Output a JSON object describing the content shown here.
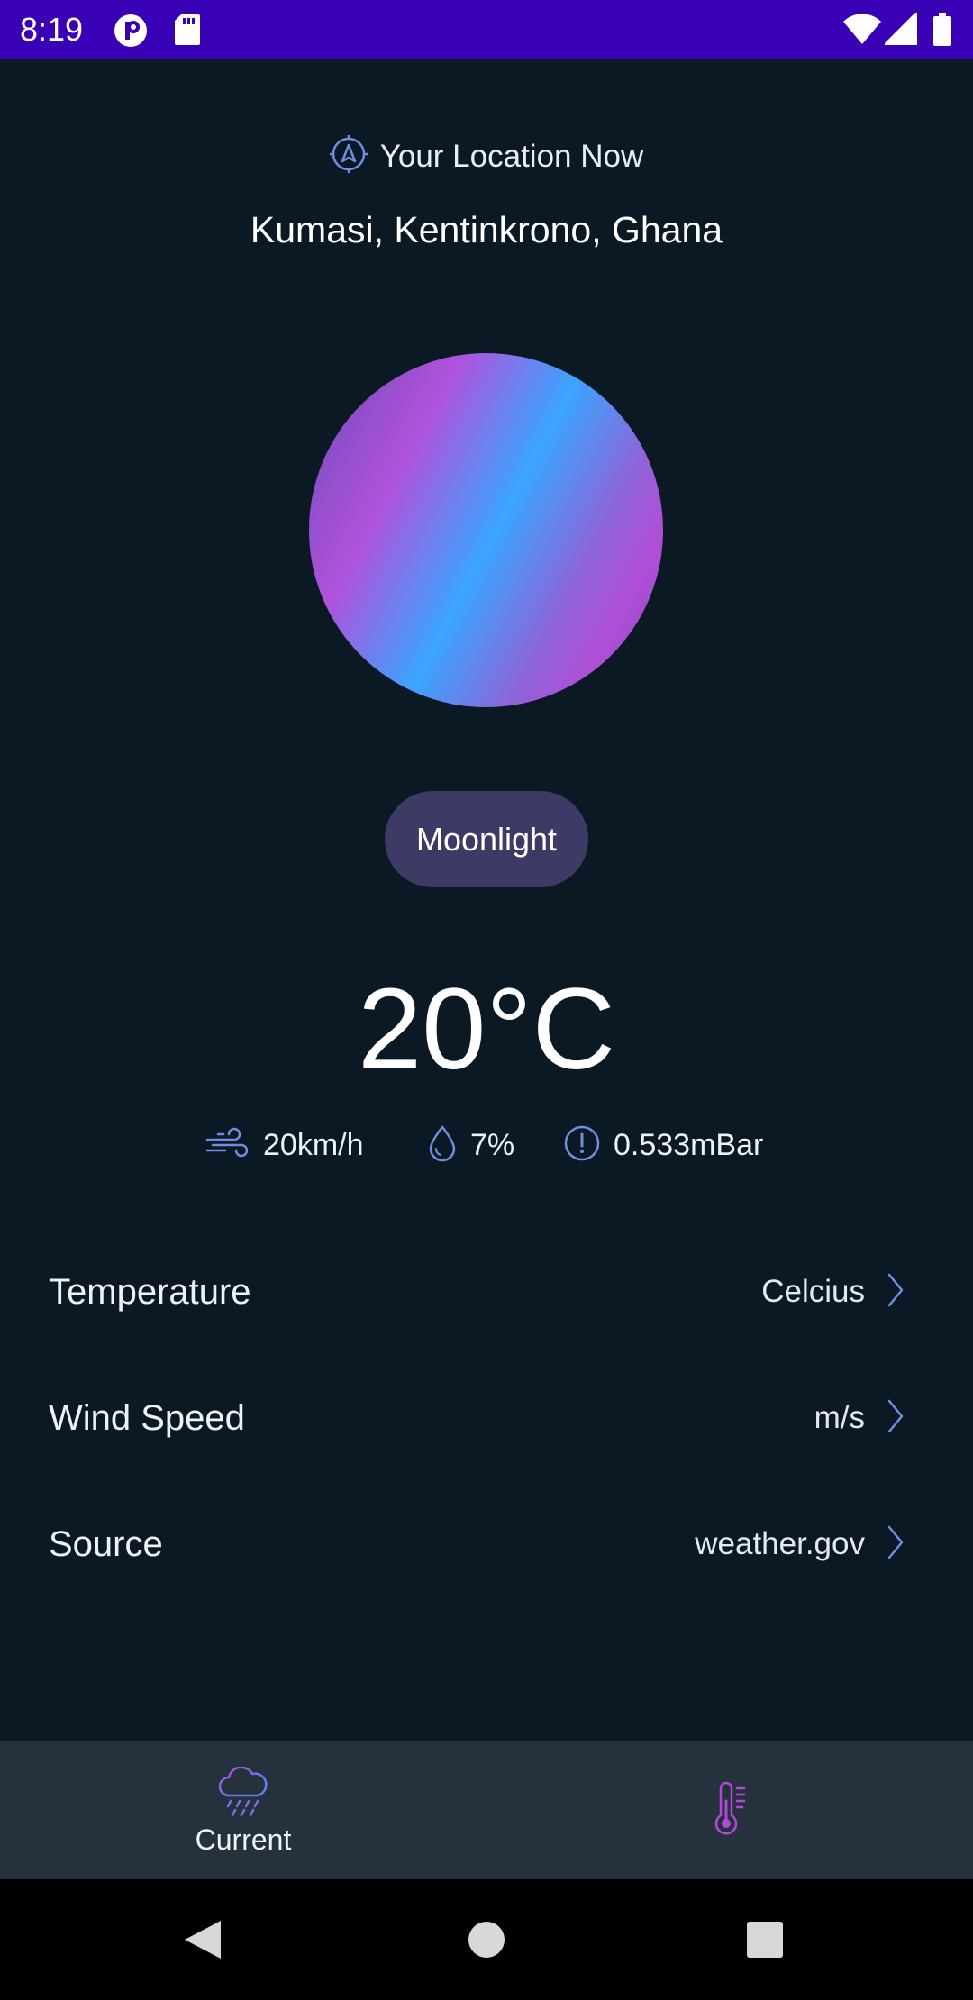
{
  "status_bar": {
    "time": "8:19",
    "background": "#3a00b5",
    "left_icons": [
      "app-p-icon",
      "sd-card-icon"
    ],
    "right_icons": [
      "wifi-icon",
      "signal-icon",
      "battery-icon"
    ]
  },
  "location": {
    "label": "Your Location Now",
    "name": "Kumasi, Kentinkrono, Ghana",
    "icon": "navigation-icon"
  },
  "condition": {
    "label": "Moonlight"
  },
  "temperature": {
    "value": "20°C"
  },
  "metrics": [
    {
      "icon": "wind-icon",
      "value": "20km/h"
    },
    {
      "icon": "droplet-icon",
      "value": "7%"
    },
    {
      "icon": "alert-circle-icon",
      "value": "0.533mBar"
    }
  ],
  "settings": [
    {
      "label": "Temperature",
      "value": "Celcius"
    },
    {
      "label": "Wind Speed",
      "value": "m/s"
    },
    {
      "label": "Source",
      "value": "weather.gov"
    }
  ],
  "bottom_nav": {
    "items": [
      {
        "label": "Current",
        "icon": "cloud-rain-icon",
        "active": true
      },
      {
        "label": "",
        "icon": "thermometer-icon",
        "active": false
      }
    ]
  },
  "colors": {
    "background": "#0b1924",
    "accent_blue": "#6e8fe0",
    "accent_purple": "#b049d8",
    "pill": "#3d3a66",
    "nav_background": "#25313c"
  }
}
